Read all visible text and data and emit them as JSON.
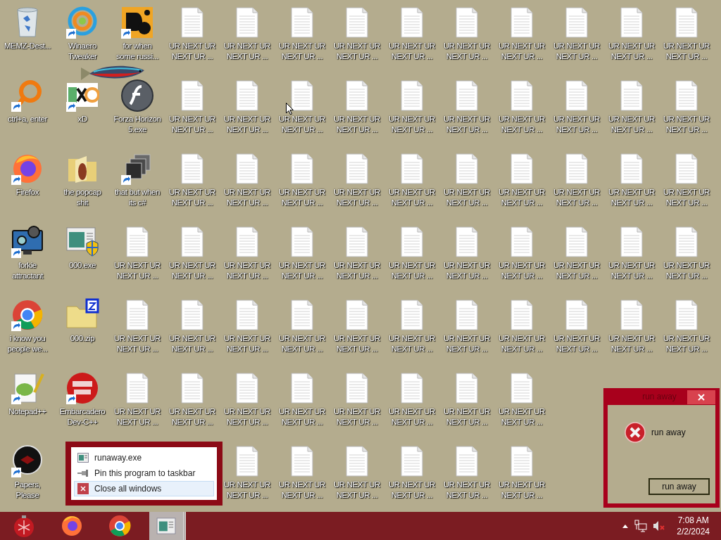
{
  "desktop": {
    "columns": [
      [
        {
          "label": "MEMZ-Dest...",
          "kind": "recycle-bin",
          "shortcut": false
        },
        {
          "label": "ctrl+a, enter",
          "kind": "ring",
          "shortcut": true
        },
        {
          "label": "Firefox",
          "kind": "firefox",
          "shortcut": true
        },
        {
          "label": "forkie attractant",
          "kind": "monitor",
          "shortcut": true
        },
        {
          "label": "i know you people we...",
          "kind": "chrome",
          "shortcut": true
        },
        {
          "label": "Notepad++",
          "kind": "notepad",
          "shortcut": true
        },
        {
          "label": "Papers, Please",
          "kind": "dark-circle",
          "shortcut": true
        }
      ],
      [
        {
          "label": "Winaero Tweaker",
          "kind": "swirl",
          "shortcut": true
        },
        {
          "label": "xD",
          "kind": "hxd",
          "shortcut": true
        },
        {
          "label": "the popcap shit",
          "kind": "folder",
          "shortcut": false
        },
        {
          "label": "000.exe",
          "kind": "window-shield",
          "shortcut": false
        },
        {
          "label": "000.zip",
          "kind": "zip",
          "shortcut": false
        },
        {
          "label": "Embarcadero Dev-C++",
          "kind": "dev",
          "shortcut": true
        }
      ],
      [
        {
          "label": "for when some russi...",
          "kind": "tile",
          "shortcut": true
        },
        {
          "label": "Forza Horizon 5.exe",
          "kind": "flash",
          "shortcut": false
        },
        {
          "label": "that but when its c#",
          "kind": "stack",
          "shortcut": true
        },
        {
          "label": "UR NEXT UR NEXT UR ...",
          "kind": "file",
          "shortcut": false
        },
        {
          "label": "UR NEXT UR NEXT UR ...",
          "kind": "file",
          "shortcut": false
        },
        {
          "label": "UR NEXT UR NEXT UR ...",
          "kind": "file",
          "shortcut": false
        }
      ],
      [
        {
          "label": "UR NEXT UR NEXT UR ...",
          "kind": "file",
          "shortcut": false
        },
        {
          "label": "UR NEXT UR NEXT UR ...",
          "kind": "file",
          "shortcut": false
        },
        {
          "label": "UR NEXT UR NEXT UR ...",
          "kind": "file",
          "shortcut": false
        },
        {
          "label": "UR NEXT UR NEXT UR ...",
          "kind": "file",
          "shortcut": false
        },
        {
          "label": "UR NEXT UR NEXT UR ...",
          "kind": "file",
          "shortcut": false
        },
        {
          "label": "UR NEXT UR NEXT UR ...",
          "kind": "file",
          "shortcut": false
        }
      ],
      [
        {
          "label": "UR NEXT UR NEXT UR ...",
          "kind": "file",
          "shortcut": false
        },
        {
          "label": "UR NEXT UR NEXT UR ...",
          "kind": "file",
          "shortcut": false
        },
        {
          "label": "UR NEXT UR NEXT UR ...",
          "kind": "file",
          "shortcut": false
        },
        {
          "label": "UR NEXT UR NEXT UR ...",
          "kind": "file",
          "shortcut": false
        },
        {
          "label": "UR NEXT UR NEXT UR ...",
          "kind": "file",
          "shortcut": false
        },
        {
          "label": "UR NEXT UR NEXT UR ...",
          "kind": "file",
          "shortcut": false
        },
        {
          "label": "UR NEXT UR NEXT UR ...",
          "kind": "file",
          "shortcut": false
        }
      ],
      [
        {
          "label": "UR NEXT UR NEXT UR ...",
          "kind": "file",
          "shortcut": false
        },
        {
          "label": "UR NEXT UR NEXT UR ...",
          "kind": "file",
          "shortcut": false
        },
        {
          "label": "UR NEXT UR NEXT UR ...",
          "kind": "file",
          "shortcut": false
        },
        {
          "label": "UR NEXT UR NEXT UR ...",
          "kind": "file",
          "shortcut": false
        },
        {
          "label": "UR NEXT UR NEXT UR ...",
          "kind": "file",
          "shortcut": false
        },
        {
          "label": "UR NEXT UR NEXT UR ...",
          "kind": "file",
          "shortcut": false
        },
        {
          "label": "UR NEXT UR NEXT UR ...",
          "kind": "file",
          "shortcut": false
        }
      ],
      [
        {
          "label": "UR NEXT UR NEXT UR ...",
          "kind": "file",
          "shortcut": false
        },
        {
          "label": "UR NEXT UR NEXT UR ...",
          "kind": "file",
          "shortcut": false
        },
        {
          "label": "UR NEXT UR NEXT UR ...",
          "kind": "file",
          "shortcut": false
        },
        {
          "label": "UR NEXT UR NEXT UR ...",
          "kind": "file",
          "shortcut": false
        },
        {
          "label": "UR NEXT UR NEXT UR ...",
          "kind": "file",
          "shortcut": false
        },
        {
          "label": "UR NEXT UR NEXT UR ...",
          "kind": "file",
          "shortcut": false
        },
        {
          "label": "UR NEXT UR NEXT UR ...",
          "kind": "file",
          "shortcut": false
        }
      ],
      [
        {
          "label": "UR NEXT UR NEXT UR ...",
          "kind": "file",
          "shortcut": false
        },
        {
          "label": "UR NEXT UR NEXT UR ...",
          "kind": "file",
          "shortcut": false
        },
        {
          "label": "UR NEXT UR NEXT UR ...",
          "kind": "file",
          "shortcut": false
        },
        {
          "label": "UR NEXT UR NEXT UR ...",
          "kind": "file",
          "shortcut": false
        },
        {
          "label": "UR NEXT UR NEXT UR ...",
          "kind": "file",
          "shortcut": false
        },
        {
          "label": "UR NEXT UR NEXT UR ...",
          "kind": "file",
          "shortcut": false
        },
        {
          "label": "UR NEXT UR NEXT UR ...",
          "kind": "file",
          "shortcut": false
        }
      ],
      [
        {
          "label": "UR NEXT UR NEXT UR ...",
          "kind": "file",
          "shortcut": false
        },
        {
          "label": "UR NEXT UR NEXT UR ...",
          "kind": "file",
          "shortcut": false
        },
        {
          "label": "UR NEXT UR NEXT UR ...",
          "kind": "file",
          "shortcut": false
        },
        {
          "label": "UR NEXT UR NEXT UR ...",
          "kind": "file",
          "shortcut": false
        },
        {
          "label": "UR NEXT UR NEXT UR ...",
          "kind": "file",
          "shortcut": false
        },
        {
          "label": "UR NEXT UR NEXT UR ...",
          "kind": "file",
          "shortcut": false
        },
        {
          "label": "UR NEXT UR NEXT UR ...",
          "kind": "file",
          "shortcut": false
        }
      ],
      [
        {
          "label": "UR NEXT UR NEXT UR ...",
          "kind": "file",
          "shortcut": false
        },
        {
          "label": "UR NEXT UR NEXT UR ...",
          "kind": "file",
          "shortcut": false
        },
        {
          "label": "UR NEXT UR NEXT UR ...",
          "kind": "file",
          "shortcut": false
        },
        {
          "label": "UR NEXT UR NEXT UR ...",
          "kind": "file",
          "shortcut": false
        },
        {
          "label": "UR NEXT UR NEXT UR ...",
          "kind": "file",
          "shortcut": false
        },
        {
          "label": "UR NEXT UR NEXT UR ...",
          "kind": "file",
          "shortcut": false
        },
        {
          "label": "UR NEXT UR NEXT UR ...",
          "kind": "file",
          "shortcut": false
        }
      ],
      [
        {
          "label": "UR NEXT UR NEXT UR ...",
          "kind": "file",
          "shortcut": false
        },
        {
          "label": "UR NEXT UR NEXT UR ...",
          "kind": "file",
          "shortcut": false
        },
        {
          "label": "UR NEXT UR NEXT UR ...",
          "kind": "file",
          "shortcut": false
        },
        {
          "label": "UR NEXT UR NEXT UR ...",
          "kind": "file",
          "shortcut": false
        },
        {
          "label": "UR NEXT UR NEXT UR ...",
          "kind": "file",
          "shortcut": false
        }
      ],
      [
        {
          "label": "UR NEXT UR NEXT UR ...",
          "kind": "file",
          "shortcut": false
        },
        {
          "label": "UR NEXT UR NEXT UR ...",
          "kind": "file",
          "shortcut": false
        },
        {
          "label": "UR NEXT UR NEXT UR ...",
          "kind": "file",
          "shortcut": false
        },
        {
          "label": "UR NEXT UR NEXT UR ...",
          "kind": "file",
          "shortcut": false
        },
        {
          "label": "UR NEXT UR NEXT UR ...",
          "kind": "file",
          "shortcut": false
        }
      ],
      [
        {
          "label": "UR NEXT UR NEXT UR ...",
          "kind": "file",
          "shortcut": false
        },
        {
          "label": "UR NEXT UR NEXT UR ...",
          "kind": "file",
          "shortcut": false
        },
        {
          "label": "UR NEXT UR NEXT UR ...",
          "kind": "file",
          "shortcut": false
        },
        {
          "label": "UR NEXT UR NEXT UR ...",
          "kind": "file",
          "shortcut": false
        },
        {
          "label": "UR NEXT UR NEXT UR ...",
          "kind": "file",
          "shortcut": false
        }
      ]
    ]
  },
  "jump_list": {
    "items": [
      {
        "label": "runaway.exe",
        "kind": "app",
        "selected": false
      },
      {
        "label": "Pin this program to taskbar",
        "kind": "pin",
        "selected": false
      },
      {
        "label": "Close all windows",
        "kind": "close",
        "selected": true
      }
    ]
  },
  "dialog": {
    "title": "run away",
    "message": "run away",
    "button": "run away"
  },
  "taskbar": {
    "items": [
      {
        "kind": "start",
        "active": false
      },
      {
        "kind": "firefox",
        "active": false
      },
      {
        "kind": "chrome",
        "active": false
      },
      {
        "kind": "window",
        "active": true
      }
    ],
    "tray": {
      "muted": true,
      "time": "7:08 AM",
      "date": "2/2/2024"
    }
  }
}
